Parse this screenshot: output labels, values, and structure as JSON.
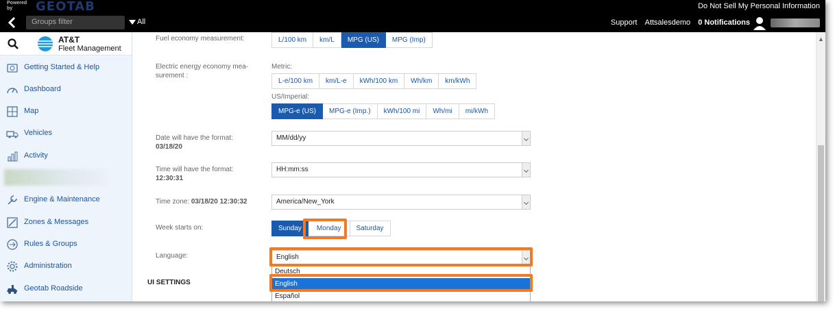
{
  "powered": {
    "by": "Powered\nby",
    "brand": "GEOTAB",
    "do_not_sell": "Do Not Sell My Personal Information"
  },
  "topnav": {
    "groups_placeholder": "Groups filter",
    "all_label": "All",
    "support": "Support",
    "user": "Attsalesdemo",
    "notifications": "0 Notifications"
  },
  "sidebar": {
    "logo_title": "AT&T",
    "logo_sub": "Fleet Management",
    "items": [
      {
        "label": "Getting Started & Help",
        "icon": "help-box-icon"
      },
      {
        "label": "Dashboard",
        "icon": "gauge-icon"
      },
      {
        "label": "Map",
        "icon": "map-icon"
      },
      {
        "label": "Vehicles",
        "icon": "truck-icon"
      },
      {
        "label": "Activity",
        "icon": "chart-icon"
      },
      {
        "label": "Engine & Maintenance",
        "icon": "wrench-icon"
      },
      {
        "label": "Zones & Messages",
        "icon": "zones-icon"
      },
      {
        "label": "Rules & Groups",
        "icon": "rules-icon"
      },
      {
        "label": "Administration",
        "icon": "gear-icon"
      },
      {
        "label": "Geotab Roadside",
        "icon": "roadside-icon"
      }
    ]
  },
  "settings": {
    "fuel": {
      "label": "Fuel economy measurement:",
      "options": [
        "L/100 km",
        "km/L",
        "MPG (US)",
        "MPG (Imp)"
      ],
      "selected": "MPG (US)"
    },
    "electric": {
      "label": "Electric energy economy mea-\nsurement :",
      "metric_label": "Metric:",
      "metric_options": [
        "L-e/100 km",
        "km/L-e",
        "kWh/100 km",
        "Wh/km",
        "km/kWh"
      ],
      "imperial_label": "US/Imperial:",
      "imperial_options": [
        "MPG-e (US)",
        "MPG-e (Imp.)",
        "kWh/100 mi",
        "Wh/mi",
        "mi/kWh"
      ],
      "imperial_selected": "MPG-e (US)"
    },
    "date": {
      "label": "Date will have the format:",
      "example": "03/18/20",
      "value": "MM/dd/yy"
    },
    "time": {
      "label": "Time will have the format:",
      "example": "12:30:31",
      "value": "HH:mm:ss"
    },
    "timezone": {
      "label": "Time zone:",
      "example": "03/18/20 12:30:32",
      "value": "America/New_York"
    },
    "week": {
      "label": "Week starts on:",
      "options": [
        "Sunday",
        "Monday",
        "Saturday"
      ],
      "selected": "Sunday"
    },
    "language": {
      "label": "Language:",
      "value": "English",
      "options": [
        "Deutsch",
        "English",
        "Español"
      ],
      "highlighted": "English"
    },
    "ui_settings": "UI SETTINGS"
  },
  "colors": {
    "accent": "#1a5bb0",
    "highlight": "#f47920",
    "sidebar_bg": "#eef4fb"
  }
}
